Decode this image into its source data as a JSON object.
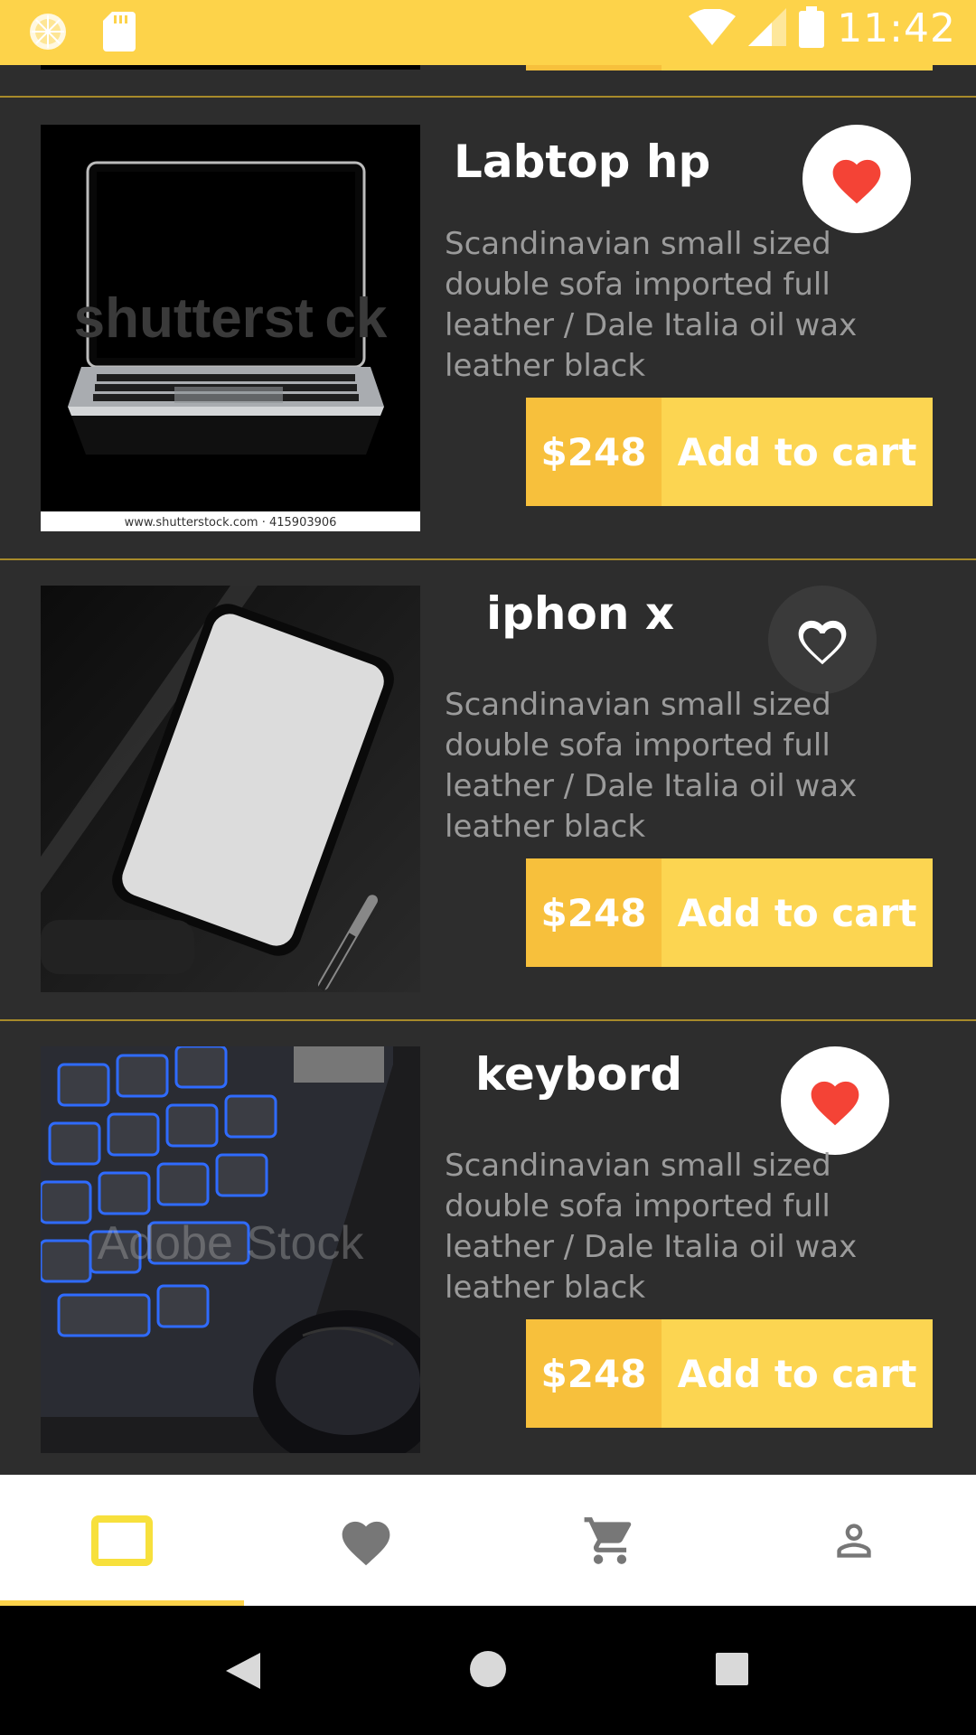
{
  "status_bar": {
    "time": "11:42",
    "icons": [
      "slice-icon",
      "sd-card-icon",
      "wifi-icon",
      "signal-icon",
      "battery-icon"
    ]
  },
  "products": [
    {
      "title": "Labtop hp",
      "description": "Scandinavian small sized double sofa imported full leather / Dale Italia oil wax leather black",
      "price": "$248",
      "button_label": "Add to cart",
      "favorite": true,
      "image": "laptop-photo",
      "image_watermark": "shutterst ck",
      "image_caption": "www.shutterstock.com · 415903906"
    },
    {
      "title": "iphon x",
      "description": "Scandinavian small sized double sofa imported full leather / Dale Italia oil wax leather black",
      "price": "$248",
      "button_label": "Add to cart",
      "favorite": false,
      "image": "phone-photo"
    },
    {
      "title": "keybord",
      "description": "Scandinavian small sized double sofa imported full leather / Dale Italia oil wax leather black",
      "price": "$248",
      "button_label": "Add to cart",
      "favorite": true,
      "image": "keyboard-photo",
      "image_watermark": "Adobe Stock"
    }
  ],
  "bottom_nav": {
    "items": [
      {
        "icon": "laptop-icon",
        "active": true
      },
      {
        "icon": "heart-icon",
        "active": false
      },
      {
        "icon": "cart-icon",
        "active": false
      },
      {
        "icon": "person-icon",
        "active": false
      }
    ]
  },
  "colors": {
    "accent": "#fdd34a",
    "price_bg": "#f7c03c",
    "background": "#2d2d2d",
    "favorite_red": "#f44336"
  }
}
